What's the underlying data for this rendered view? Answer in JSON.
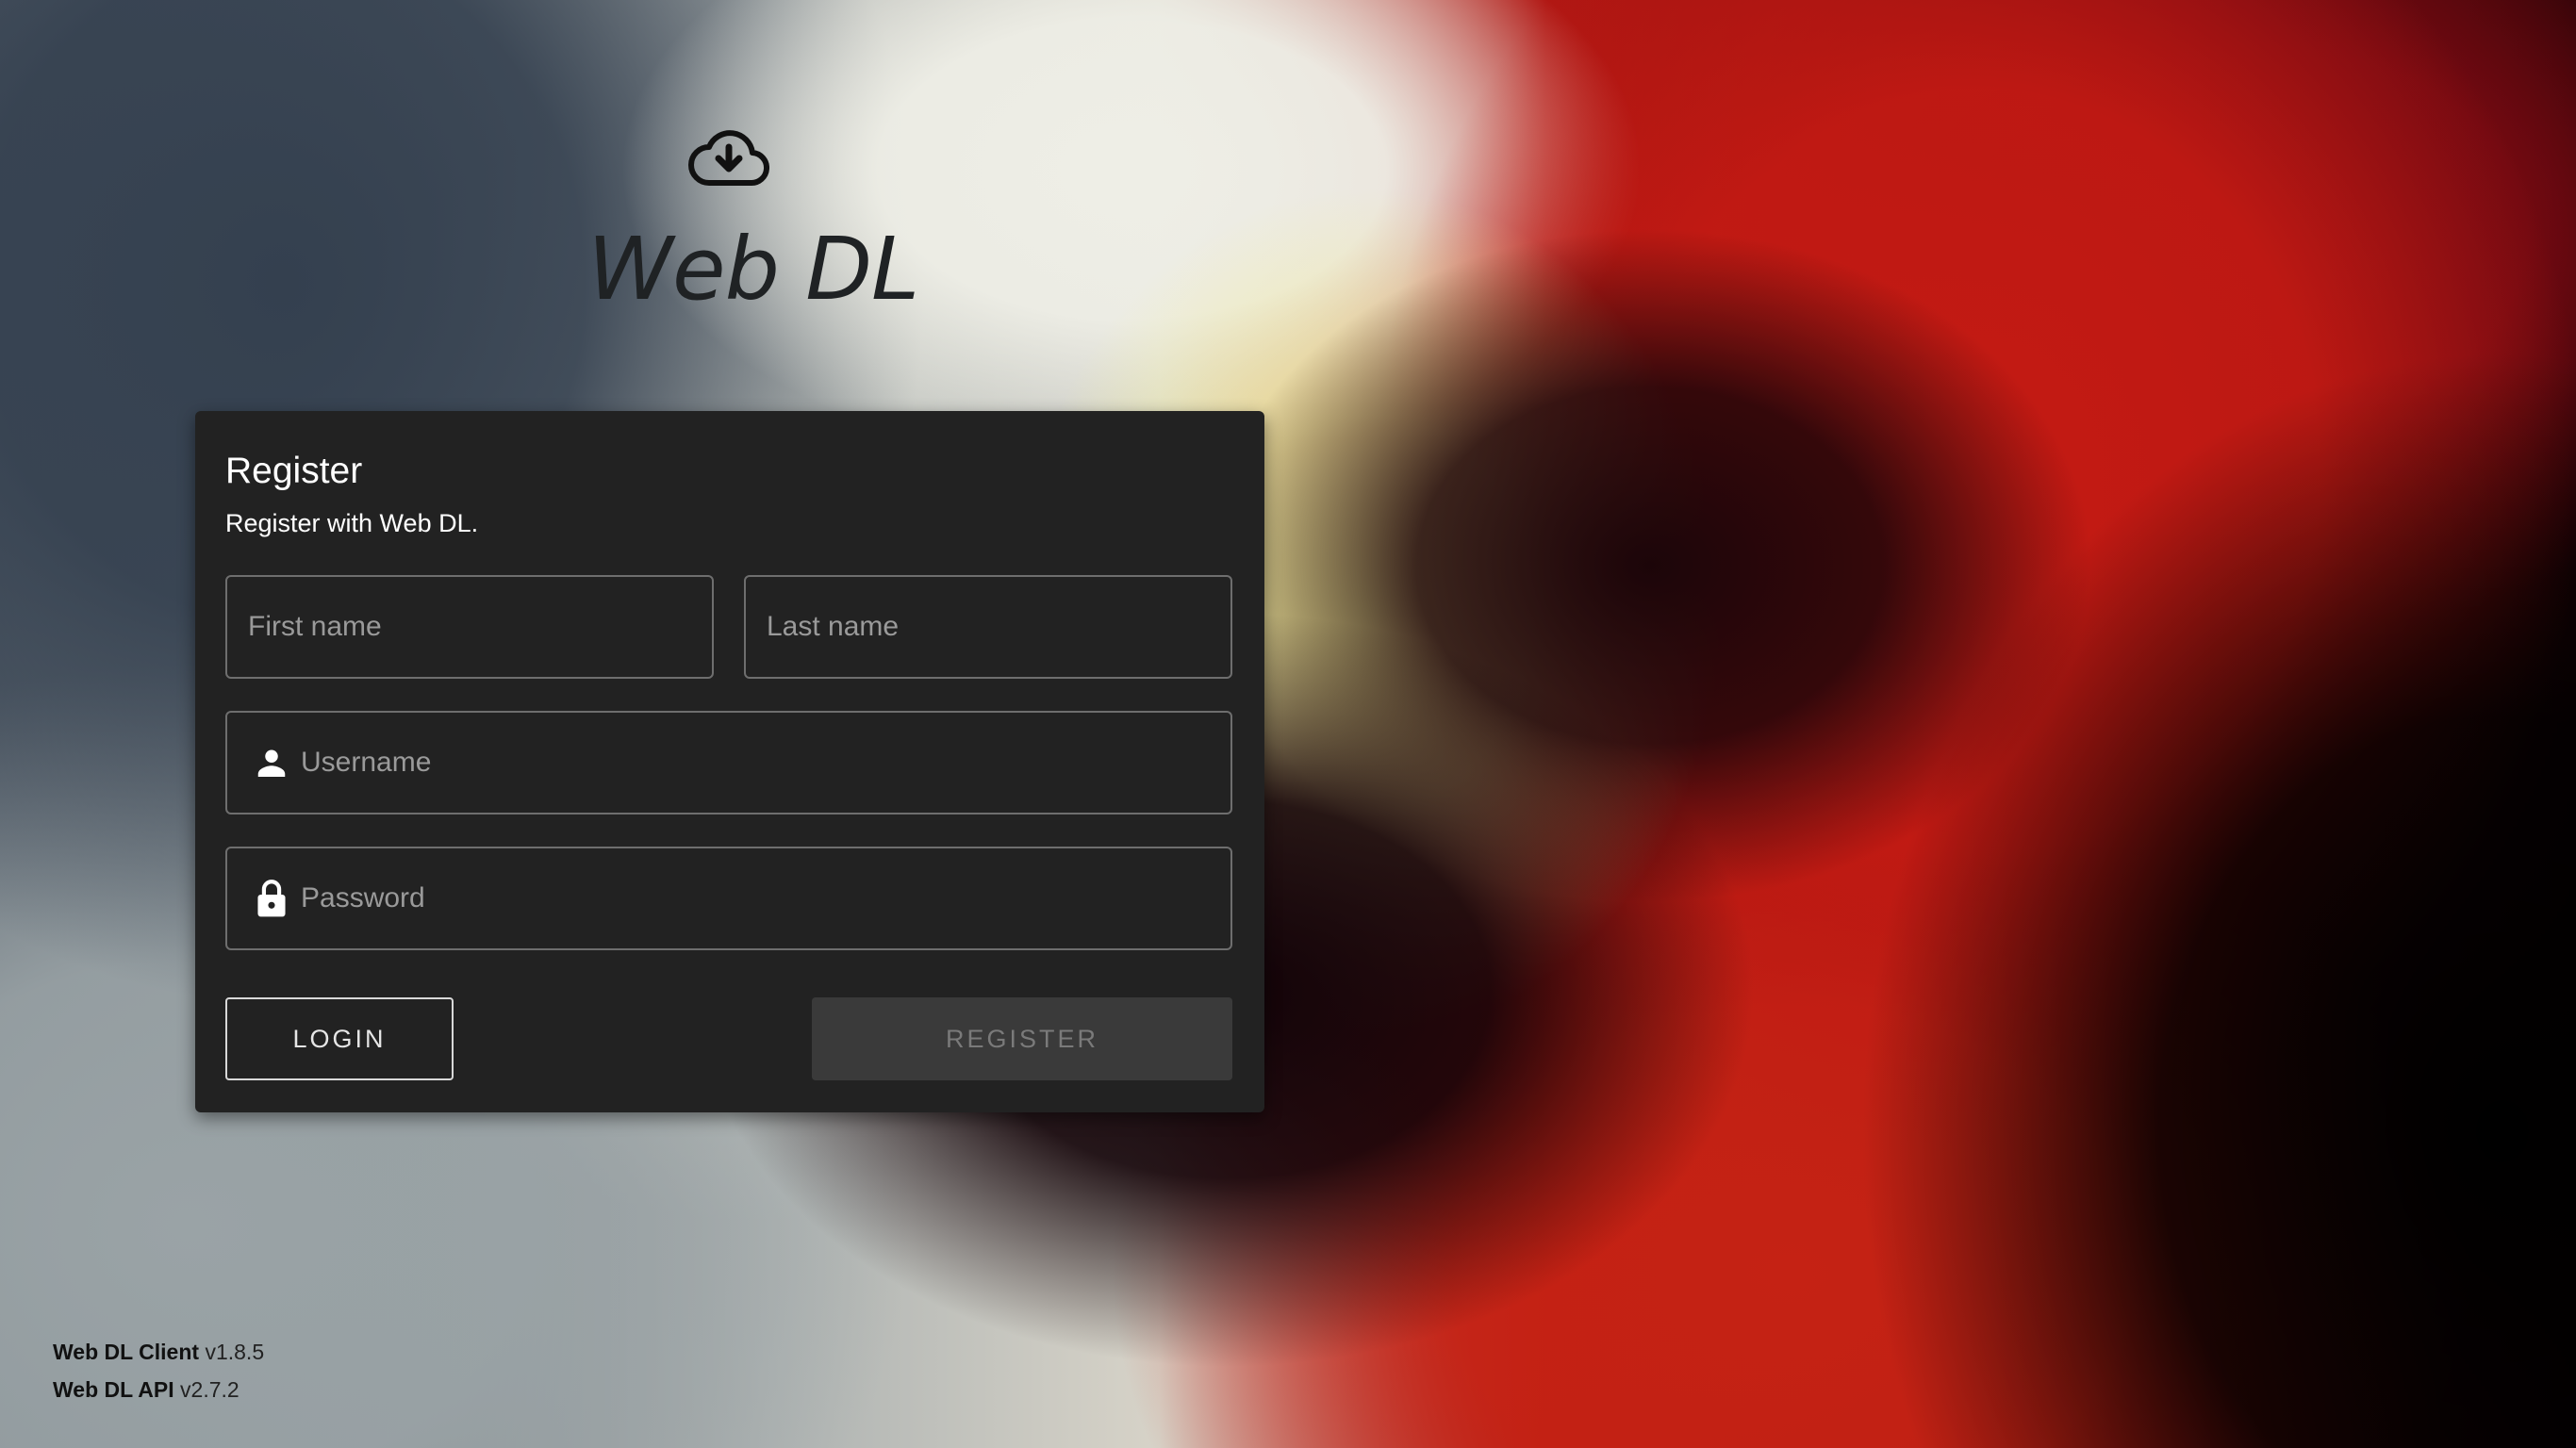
{
  "app": {
    "title": "Web DL",
    "logo_icon": "cloud-download-icon"
  },
  "register_card": {
    "title": "Register",
    "subtitle": "Register with Web DL.",
    "first_name_placeholder": "First name",
    "last_name_placeholder": "Last name",
    "username_placeholder": "Username",
    "username_icon": "person-icon",
    "password_placeholder": "Password",
    "password_icon": "lock-icon",
    "login_label": "LOGIN",
    "register_label": "REGISTER"
  },
  "footer": {
    "client_name": "Web DL Client",
    "client_version": "v1.8.5",
    "api_name": "Web DL API",
    "api_version": "v2.7.2"
  },
  "colors": {
    "card_background": "#222222",
    "field_border": "#6e6e6e",
    "register_button_background": "#3a3a3a"
  }
}
